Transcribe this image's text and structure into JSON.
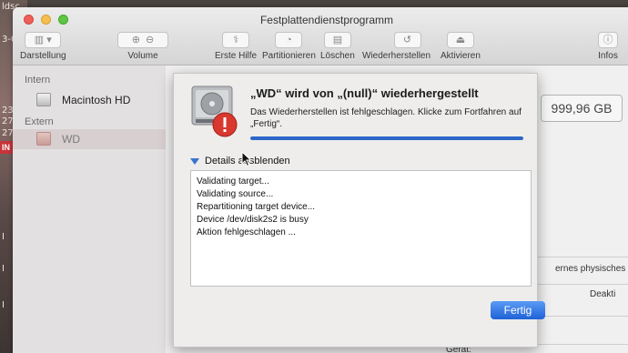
{
  "desktop": {
    "labels": [
      "ldsc",
      "3-01",
      "237",
      "277",
      "277",
      "I",
      "I",
      "I"
    ],
    "badge": "IN"
  },
  "window": {
    "title": "Festplattendienstprogramm",
    "toolbar": {
      "darstellung": "Darstellung",
      "volume": "Volume",
      "erste_hilfe": "Erste Hilfe",
      "partitionieren": "Partitionieren",
      "loeschen": "Löschen",
      "wiederherstellen": "Wiederherstellen",
      "aktivieren": "Aktivieren",
      "infos": "Infos"
    }
  },
  "sidebar": {
    "intern_heading": "Intern",
    "extern_heading": "Extern",
    "items": [
      {
        "label": "Macintosh HD"
      },
      {
        "label": "WD"
      }
    ]
  },
  "main": {
    "capacity": "999,96 GB",
    "info_right_1": "ernes physisches Volu",
    "info_right_2": "Deakti",
    "bottom_label": "Gerät:"
  },
  "sheet": {
    "title": "„WD“ wird von „(null)“ wiederhergestellt",
    "message": "Das Wiederherstellen ist fehlgeschlagen. Klicke zum Fortfahren auf „Fertig“.",
    "progress": 1.0,
    "details_toggle": "Details ausblenden",
    "log": [
      "Validating target...",
      "Validating source...",
      "Repartitioning target device...",
      "Device /dev/disk2s2 is busy",
      "Aktion fehlgeschlagen ..."
    ],
    "done_button": "Fertig"
  },
  "colors": {
    "accent": "#2d66c8",
    "alert": "#d9382f"
  }
}
